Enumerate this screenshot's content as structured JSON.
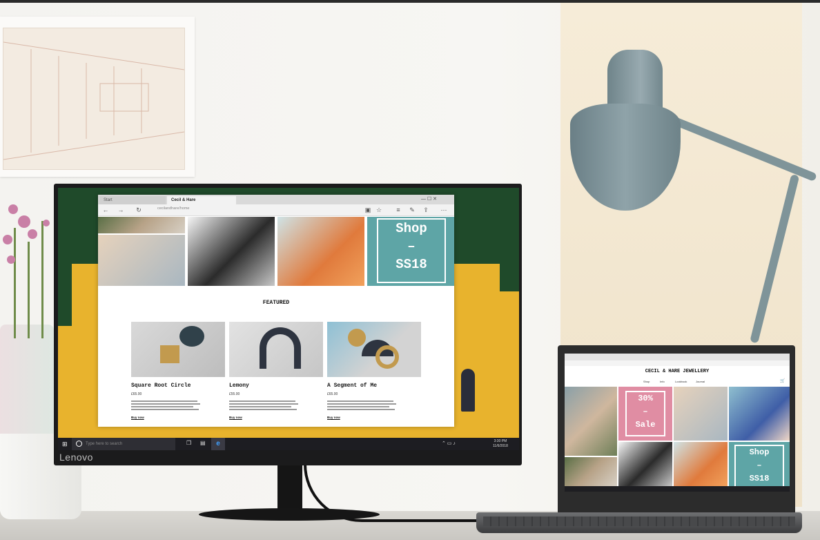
{
  "monitor": {
    "brand": "Lenovo",
    "browser": {
      "tabs": [
        {
          "label": "Start"
        },
        {
          "label": "Cecil & Hare"
        }
      ],
      "url": "cecilandhare/home",
      "shop_banner": {
        "line1": "Shop",
        "line2": "–",
        "line3": "SS18"
      },
      "featured_heading": "FEATURED",
      "products": [
        {
          "title": "Square Root Circle",
          "price": "£65.00",
          "cta": "Buy now"
        },
        {
          "title": "Lemony",
          "price": "£55.00",
          "cta": "Buy now"
        },
        {
          "title": "A Segment of Me",
          "price": "£65.00",
          "cta": "Buy now"
        }
      ]
    },
    "taskbar": {
      "search_placeholder": "Type here to search",
      "time": "3:30 PM",
      "date": "11/6/2018"
    }
  },
  "laptop": {
    "site_title": "CECIL & HARE JEWELLERY",
    "nav": [
      "Shop",
      "Info",
      "Lookbook",
      "Journal"
    ],
    "sale_banner": {
      "line1": "30%",
      "line2": "–",
      "line3": "Sale"
    },
    "shop_banner": {
      "line1": "Shop",
      "line2": "–",
      "line3": "SS18"
    }
  },
  "colors": {
    "accent_teal": "#5ea5a6",
    "accent_pink": "#e08da3",
    "wallpaper_yellow": "#e8b32d",
    "wallpaper_green": "#1f4a2a"
  }
}
